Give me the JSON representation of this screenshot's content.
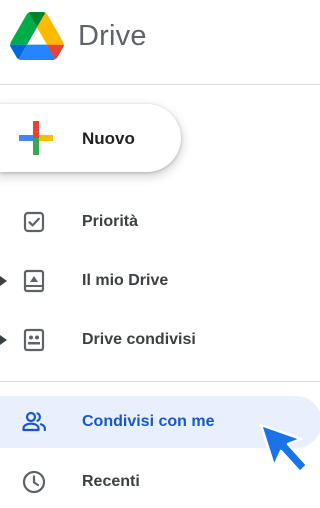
{
  "app": {
    "title": "Drive"
  },
  "new_button": {
    "label": "Nuovo"
  },
  "nav": [
    {
      "label": "Priorità",
      "icon": "priority-checkbox-icon"
    },
    {
      "label": "Il mio Drive",
      "icon": "my-drive-icon",
      "expandable": true
    },
    {
      "label": "Drive condivisi",
      "icon": "shared-drives-icon",
      "expandable": true
    },
    {
      "label": "Condivisi con me",
      "icon": "people-icon",
      "active": true
    },
    {
      "label": "Recenti",
      "icon": "clock-icon"
    }
  ],
  "colors": {
    "accent": "#1a56c8",
    "active_bg": "#e8f0fe",
    "icon_gray": "#5f6368",
    "divider": "#dadce0",
    "cursor": "#1a73e8"
  }
}
